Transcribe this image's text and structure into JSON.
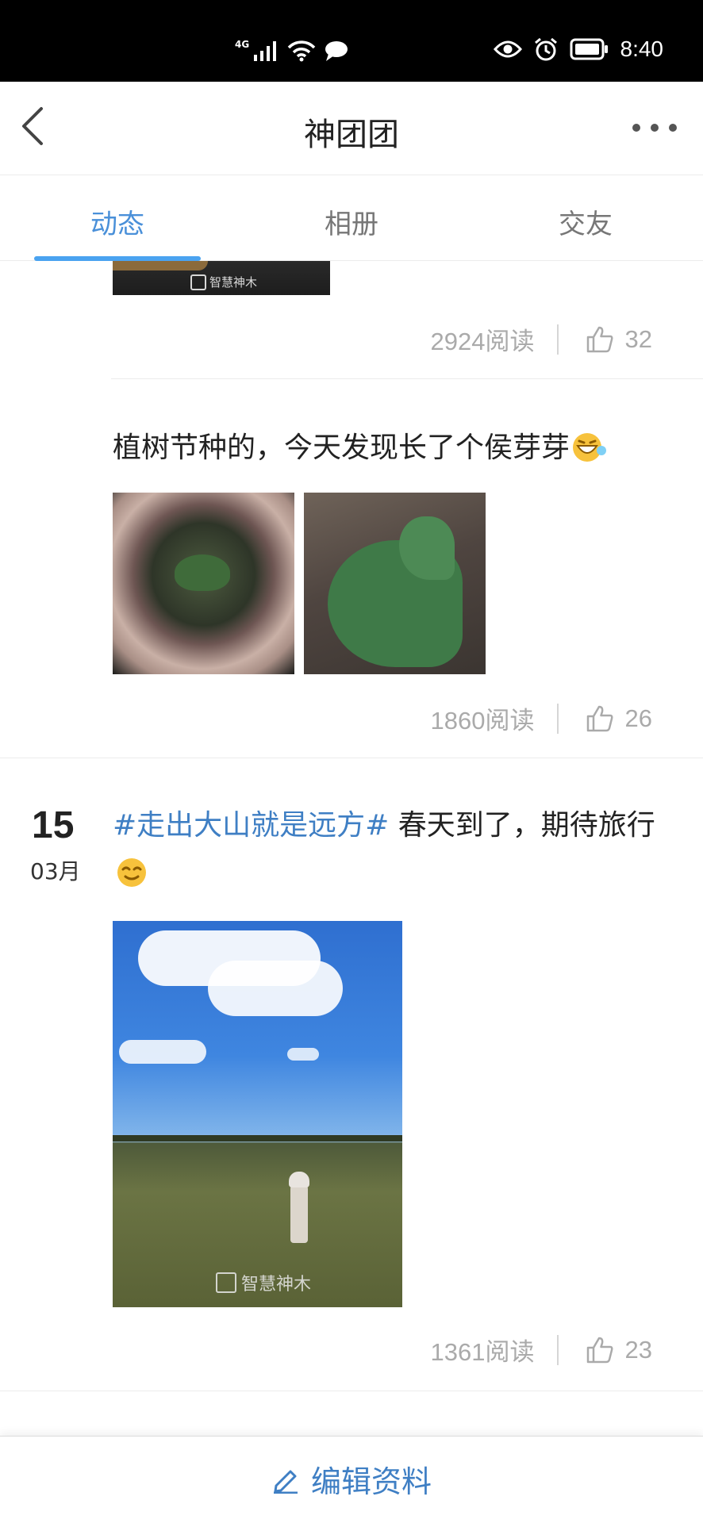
{
  "status_bar": {
    "network": "4G",
    "time": "8:40",
    "icons": [
      "signal-icon",
      "wifi-icon",
      "message-icon",
      "eye-icon",
      "alarm-icon",
      "battery-icon"
    ]
  },
  "header": {
    "title": "神团团",
    "back_icon": "chevron-left-icon",
    "more_icon": "more-dots-icon"
  },
  "tabs": [
    {
      "label": "动态",
      "active": true
    },
    {
      "label": "相册",
      "active": false
    },
    {
      "label": "交友",
      "active": false
    }
  ],
  "posts": [
    {
      "reads": "2924阅读",
      "likes": "32",
      "image_watermark": "智慧神木"
    },
    {
      "text": "植树节种的，今天发现长了个侯芽芽",
      "emoji": "grinning-face-icon",
      "images": [
        "potted-sprout-photo",
        "sprout-closeup-photo"
      ],
      "reads": "1860阅读",
      "likes": "26"
    },
    {
      "day": "15",
      "month": "03月",
      "hashtag": "#走出大山就是远方#",
      "text": " 春天到了，期待旅行",
      "emoji": "smiling-face-icon",
      "images": [
        "child-in-grassland-photo"
      ],
      "image_watermark": "智慧神木",
      "reads": "1361阅读",
      "likes": "23"
    }
  ],
  "bottom_bar": {
    "edit_label": "编辑资料",
    "edit_icon": "pencil-icon"
  },
  "colors": {
    "accent": "#3f7fc4",
    "tab_active": "#4a90d9",
    "tab_underline": "#4aa3f0",
    "meta_text": "#aaaaaa"
  }
}
